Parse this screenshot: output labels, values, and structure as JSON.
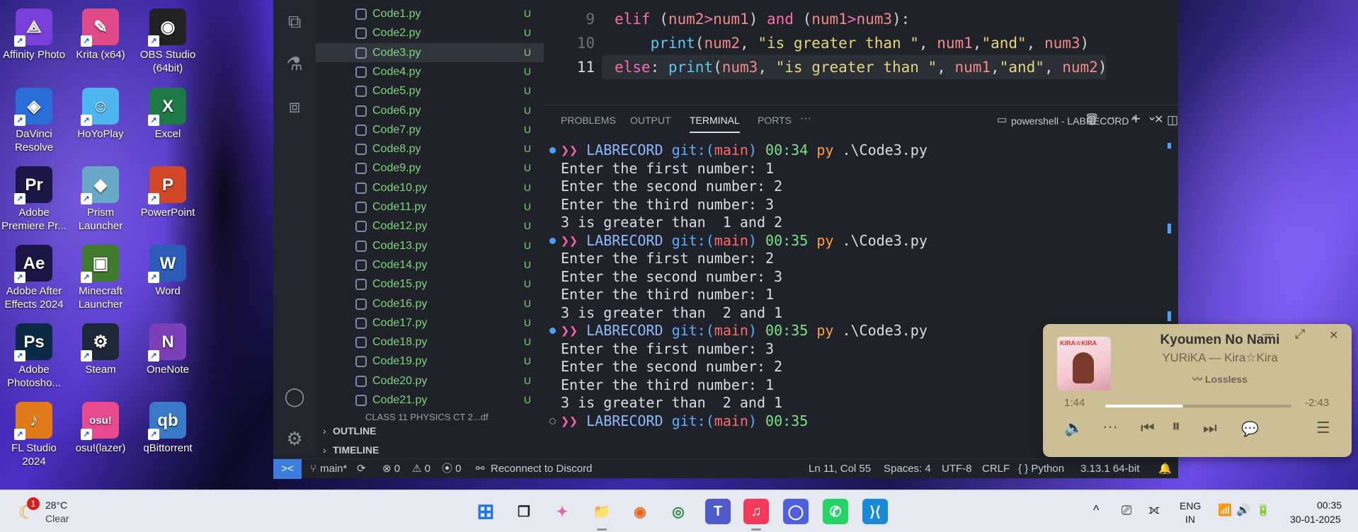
{
  "desktop": {
    "icons": [
      {
        "label": "Affinity Photo",
        "icon": "affinity-photo-icon",
        "color": "#7a3fd8",
        "glyph": "⟁"
      },
      {
        "label": "Krita (x64)",
        "icon": "krita-icon",
        "color": "#e04a8a",
        "glyph": "✎"
      },
      {
        "label": "OBS Studio (64bit)",
        "icon": "obs-icon",
        "color": "#222222",
        "glyph": "◉"
      },
      {
        "label": "DaVinci Resolve",
        "icon": "davinci-resolve-icon",
        "color": "#2a6cd8",
        "glyph": "◈"
      },
      {
        "label": "HoYoPlay",
        "icon": "hoyoplay-icon",
        "color": "#4fb6f0",
        "glyph": "☺"
      },
      {
        "label": "Excel",
        "icon": "excel-icon",
        "color": "#1d7a44",
        "glyph": "X"
      },
      {
        "label": "Adobe Premiere Pr...",
        "icon": "premiere-icon",
        "color": "#1c1646",
        "glyph": "Pr"
      },
      {
        "label": "Prism Launcher",
        "icon": "prism-launcher-icon",
        "color": "#6aa8c8",
        "glyph": "◆"
      },
      {
        "label": "PowerPoint",
        "icon": "powerpoint-icon",
        "color": "#d24726",
        "glyph": "P"
      },
      {
        "label": "Adobe After Effects 2024",
        "icon": "after-effects-icon",
        "color": "#1c1646",
        "glyph": "Ae"
      },
      {
        "label": "Minecraft Launcher",
        "icon": "minecraft-icon",
        "color": "#3f7a2d",
        "glyph": "▣"
      },
      {
        "label": "Word",
        "icon": "word-icon",
        "color": "#2b5cb8",
        "glyph": "W"
      },
      {
        "label": "Adobe Photosho...",
        "icon": "photoshop-icon",
        "color": "#0b2a44",
        "glyph": "Ps"
      },
      {
        "label": "Steam",
        "icon": "steam-icon",
        "color": "#1b2838",
        "glyph": "⚙"
      },
      {
        "label": "OneNote",
        "icon": "onenote-icon",
        "color": "#7b3fb8",
        "glyph": "N"
      },
      {
        "label": "FL Studio 2024",
        "icon": "fl-studio-icon",
        "color": "#e07a1a",
        "glyph": "♪"
      },
      {
        "label": "osu!(lazer)",
        "icon": "osu-icon",
        "color": "#e84a8e",
        "glyph": "osu!"
      },
      {
        "label": "qBittorrent",
        "icon": "qbittorrent-icon",
        "color": "#3a78c8",
        "glyph": "qb"
      }
    ]
  },
  "vscode": {
    "explorer_files": [
      {
        "name": "Code1.py",
        "status": "U"
      },
      {
        "name": "Code2.py",
        "status": "U"
      },
      {
        "name": "Code3.py",
        "status": "U"
      },
      {
        "name": "Code4.py",
        "status": "U"
      },
      {
        "name": "Code5.py",
        "status": "U"
      },
      {
        "name": "Code6.py",
        "status": "U"
      },
      {
        "name": "Code7.py",
        "status": "U"
      },
      {
        "name": "Code8.py",
        "status": "U"
      },
      {
        "name": "Code9.py",
        "status": "U"
      },
      {
        "name": "Code10.py",
        "status": "U"
      },
      {
        "name": "Code11.py",
        "status": "U"
      },
      {
        "name": "Code12.py",
        "status": "U"
      },
      {
        "name": "Code13.py",
        "status": "U"
      },
      {
        "name": "Code14.py",
        "status": "U"
      },
      {
        "name": "Code15.py",
        "status": "U"
      },
      {
        "name": "Code16.py",
        "status": "U"
      },
      {
        "name": "Code17.py",
        "status": "U"
      },
      {
        "name": "Code18.py",
        "status": "U"
      },
      {
        "name": "Code19.py",
        "status": "U"
      },
      {
        "name": "Code20.py",
        "status": "U"
      },
      {
        "name": "Code21.py",
        "status": "U"
      }
    ],
    "active_file_index": 2,
    "partial_item": "CLASS 11 PHYSICS CT 2...df",
    "sections": {
      "outline": "OUTLINE",
      "timeline": "TIMELINE"
    },
    "editor": {
      "lines": [
        {
          "number": "9",
          "tokens": [
            {
              "t": "elif",
              "c": "kw"
            },
            {
              "t": " (",
              "c": "pl"
            },
            {
              "t": "num2",
              "c": "var"
            },
            {
              "t": ">",
              "c": "op"
            },
            {
              "t": "num1",
              "c": "var"
            },
            {
              "t": ") ",
              "c": "pl"
            },
            {
              "t": "and",
              "c": "kw"
            },
            {
              "t": " (",
              "c": "pl"
            },
            {
              "t": "num1",
              "c": "var"
            },
            {
              "t": ">",
              "c": "op"
            },
            {
              "t": "num3",
              "c": "var"
            },
            {
              "t": "):",
              "c": "pl"
            }
          ]
        },
        {
          "number": "10",
          "tokens": [
            {
              "t": "    ",
              "c": "pl"
            },
            {
              "t": "print",
              "c": "fn"
            },
            {
              "t": "(",
              "c": "pl"
            },
            {
              "t": "num2",
              "c": "var"
            },
            {
              "t": ", ",
              "c": "pl"
            },
            {
              "t": "\"is greater than \"",
              "c": "str"
            },
            {
              "t": ", ",
              "c": "pl"
            },
            {
              "t": "num1",
              "c": "var"
            },
            {
              "t": ",",
              "c": "pl"
            },
            {
              "t": "\"and\"",
              "c": "str"
            },
            {
              "t": ", ",
              "c": "pl"
            },
            {
              "t": "num3",
              "c": "var"
            },
            {
              "t": ")",
              "c": "pl"
            }
          ]
        },
        {
          "number": "11",
          "tokens": [
            {
              "t": "else",
              "c": "kw"
            },
            {
              "t": ": ",
              "c": "pl"
            },
            {
              "t": "print",
              "c": "fn"
            },
            {
              "t": "(",
              "c": "pl"
            },
            {
              "t": "num3",
              "c": "var"
            },
            {
              "t": ", ",
              "c": "pl"
            },
            {
              "t": "\"is greater than \"",
              "c": "str"
            },
            {
              "t": ", ",
              "c": "pl"
            },
            {
              "t": "num1",
              "c": "var"
            },
            {
              "t": ",",
              "c": "pl"
            },
            {
              "t": "\"and\"",
              "c": "str"
            },
            {
              "t": ", ",
              "c": "pl"
            },
            {
              "t": "num2",
              "c": "var"
            },
            {
              "t": ")",
              "c": "pl"
            }
          ]
        }
      ],
      "current_line": "11"
    },
    "panel": {
      "tabs": [
        "PROBLEMS",
        "OUTPUT",
        "TERMINAL",
        "PORTS"
      ],
      "active_tab": "TERMINAL",
      "more": "···",
      "terminal_name": "powershell - LABRECORD",
      "add": "+",
      "chevron": "⌄",
      "split": "◫",
      "trash": "🗑",
      "more_actions": "···",
      "maximize": "^",
      "close": "✕"
    },
    "terminal": {
      "prompt_arrows": "❯❯",
      "dir": "LABRECORD",
      "git": "git:(",
      "branch": "main",
      "git_close": ")",
      "runs": [
        {
          "time": "00:34",
          "cmd": "py",
          "arg": ".\\Code3.py",
          "output": [
            "Enter the first number: 1",
            "Enter the second number: 2",
            "Enter the third number: 3",
            "3 is greater than  1 and 2"
          ]
        },
        {
          "time": "00:35",
          "cmd": "py",
          "arg": ".\\Code3.py",
          "output": [
            "Enter the first number: 2",
            "Enter the second number: 3",
            "Enter the third number: 1",
            "3 is greater than  2 and 1"
          ]
        },
        {
          "time": "00:35",
          "cmd": "py",
          "arg": ".\\Code3.py",
          "output": [
            "Enter the first number: 3",
            "Enter the second number: 2",
            "Enter the third number: 1",
            "3 is greater than  2 and 1"
          ]
        }
      ],
      "last_prompt_time": "00:35",
      "dot_color": "#4aa0ff"
    },
    "statusbar": {
      "remote": "><",
      "branch": "main*",
      "sync": "⟳",
      "errors": "⊗ 0",
      "warnings": "⚠ 0",
      "ports": "⦿ 0",
      "discord": "Reconnect to Discord",
      "position": "Ln 11, Col 55",
      "spaces": "Spaces: 4",
      "encoding": "UTF-8",
      "eol": "CRLF",
      "language": "{ } Python",
      "interpreter": "3.13.1 64-bit",
      "bell": "🔔"
    }
  },
  "media": {
    "title": "Kyoumen No Nami",
    "artist": "YURiKA — Kira☆Kira",
    "quality": "Lossless",
    "elapsed": "1:44",
    "remaining": "-2:43",
    "progress": 0.42,
    "album_tag": "KIRA☆KIRA",
    "minimize": "—",
    "expand": "⤢",
    "close": "✕",
    "controls": {
      "volume": "🔉",
      "more": "···",
      "prev": "⏮",
      "pause": "⏸",
      "next": "⏭",
      "lyrics": "💬",
      "queue": "☰"
    }
  },
  "taskbar": {
    "weather": {
      "badge": "1",
      "temp": "28°C",
      "cond": "Clear"
    },
    "apps": [
      {
        "name": "start-icon",
        "glyph": "⊞",
        "color": "#1a73e8",
        "bg": "transparent"
      },
      {
        "name": "task-view-icon",
        "glyph": "❐",
        "color": "#222",
        "bg": "transparent"
      },
      {
        "name": "copilot-icon",
        "glyph": "✦",
        "color": "#e06aa8",
        "bg": "transparent"
      },
      {
        "name": "file-explorer-icon",
        "glyph": "📁",
        "color": "#e0a81a",
        "bg": "transparent",
        "running": true
      },
      {
        "name": "firefox-icon",
        "glyph": "◉",
        "color": "#e8661a",
        "bg": "transparent"
      },
      {
        "name": "chrome-icon",
        "glyph": "◎",
        "color": "#2a8a3a",
        "bg": "transparent"
      },
      {
        "name": "teams-icon",
        "glyph": "T",
        "color": "#fff",
        "bg": "#5059c9"
      },
      {
        "name": "music-icon",
        "glyph": "♫",
        "color": "#fff",
        "bg": "#f23a5a",
        "running": true
      },
      {
        "name": "app-circle-icon",
        "glyph": "◯",
        "color": "#fff",
        "bg": "#4f5fe0"
      },
      {
        "name": "whatsapp-icon",
        "glyph": "✆",
        "color": "#fff",
        "bg": "#25d366"
      },
      {
        "name": "vscode-icon",
        "glyph": "⟩⟨",
        "color": "#fff",
        "bg": "#1a8ad8",
        "active": true
      }
    ],
    "tray": {
      "chevron": "^",
      "usb": "⎚",
      "bluetooth": "⟗",
      "lang1": "ENG",
      "lang2": "IN",
      "wifi": "📶",
      "volume": "🔊",
      "battery": "🔋",
      "time": "00:35",
      "date": "30-01-2025"
    }
  }
}
